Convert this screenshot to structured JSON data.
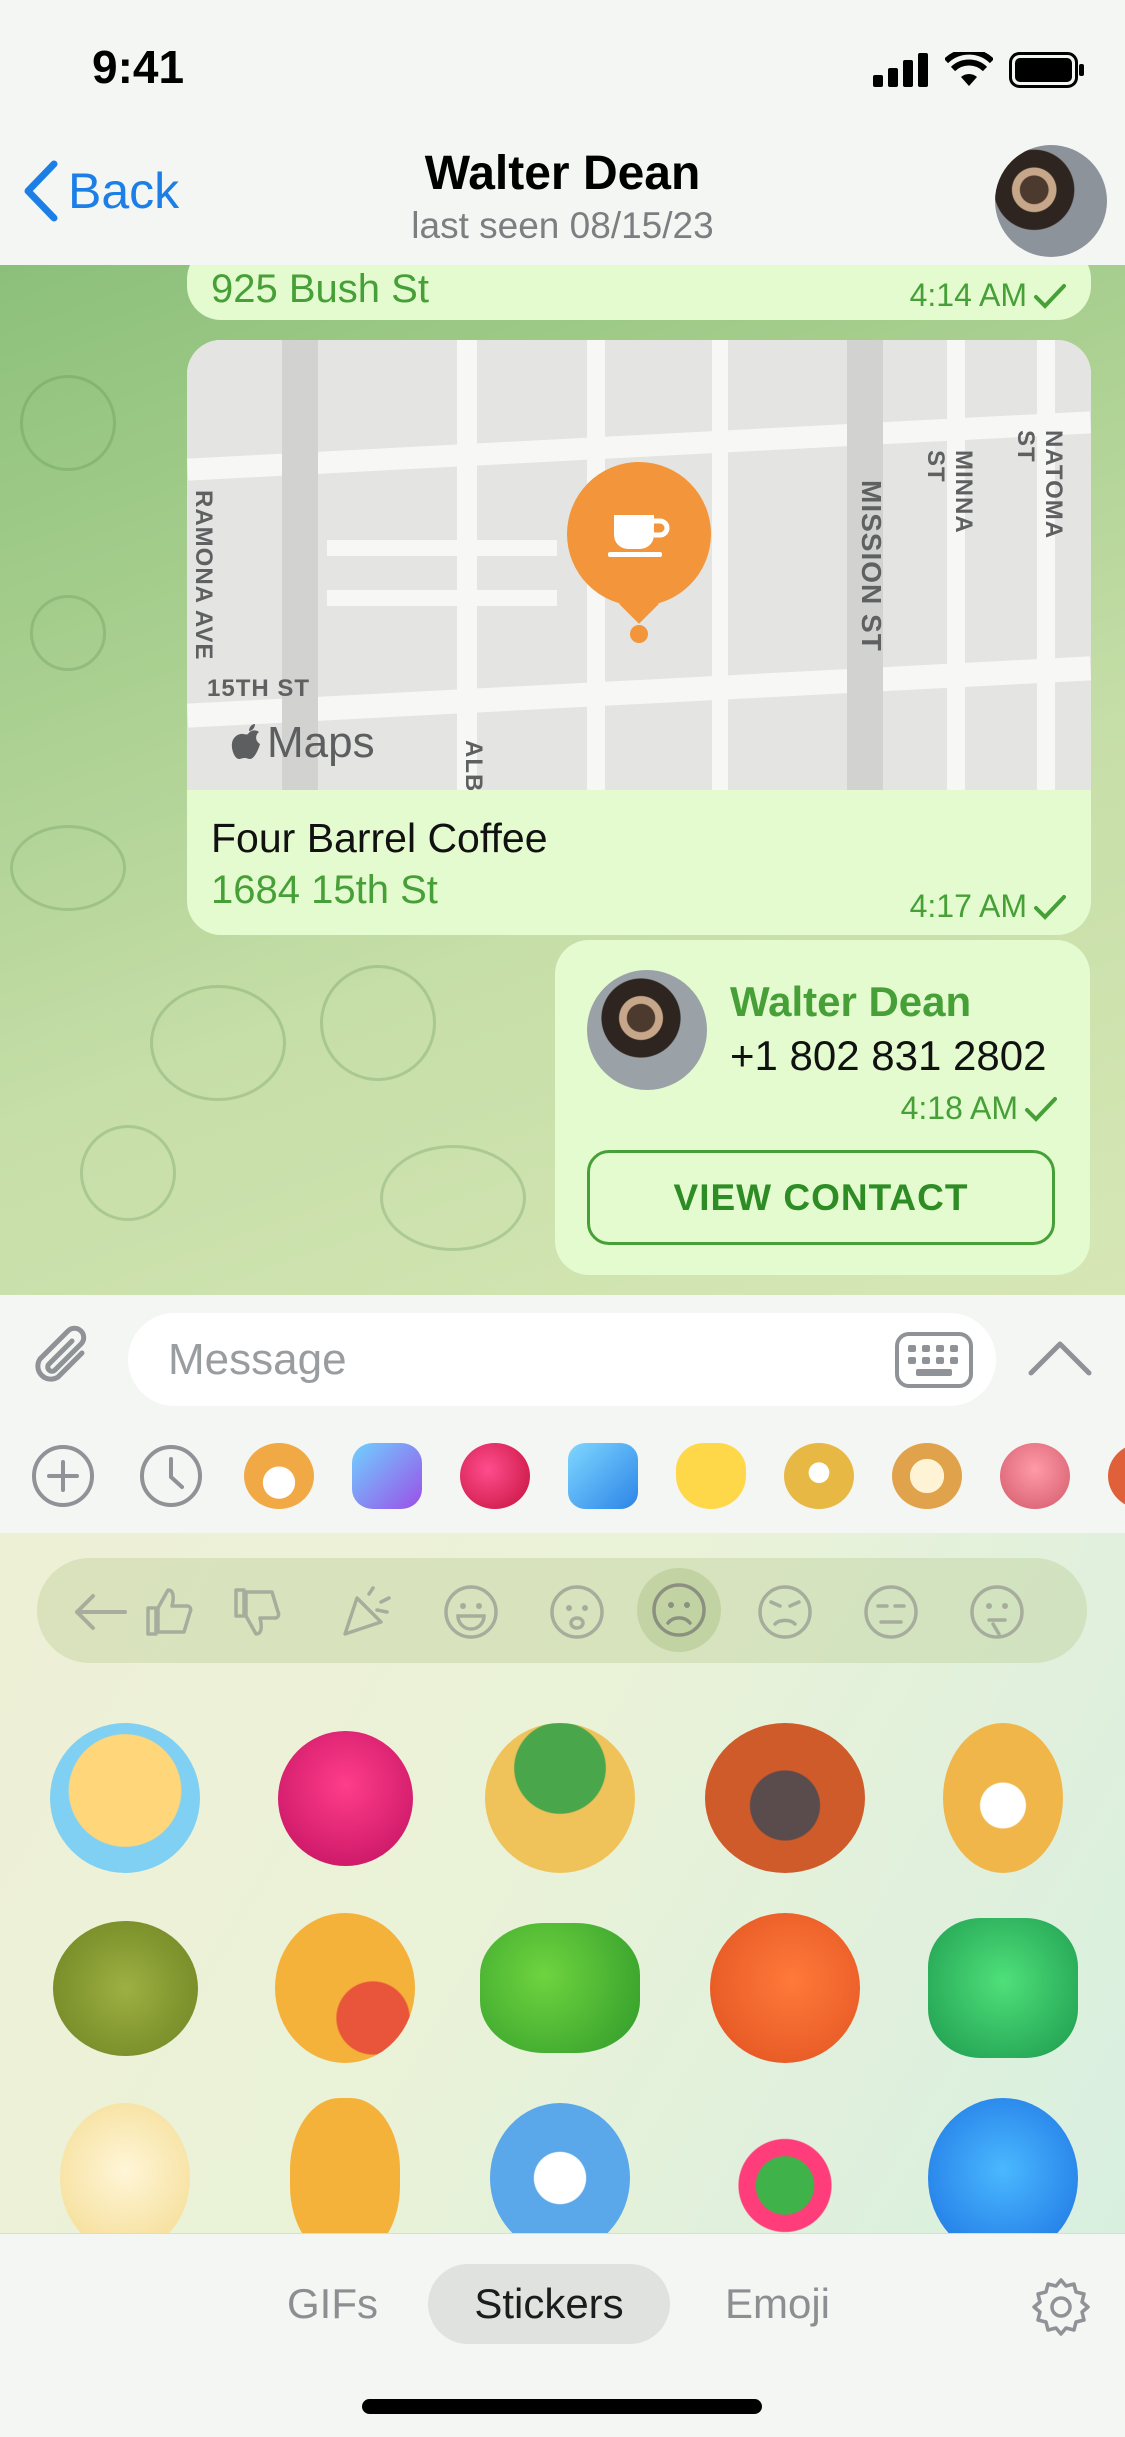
{
  "status_bar": {
    "time": "9:41"
  },
  "header": {
    "back_label": "Back",
    "contact_name": "Walter Dean",
    "last_seen": "last seen 08/15/23"
  },
  "messages": {
    "address": {
      "text": "925 Bush St",
      "time": "4:14 AM"
    },
    "location": {
      "venue": "Four Barrel Coffee",
      "address": "1684 15th St",
      "time": "4:17 AM",
      "map_provider": "Maps",
      "street_labels": [
        "MISSION ST",
        "MINNA ST",
        "NATOMA ST",
        "RAMONA AVE",
        "15TH ST",
        "ALB"
      ]
    },
    "contact": {
      "name": "Walter Dean",
      "phone": "+1 802 831 2802",
      "time": "4:18 AM",
      "button": "VIEW CONTACT"
    }
  },
  "composer": {
    "placeholder": "Message"
  },
  "tabs": {
    "gifs": "GIFs",
    "stickers": "Stickers",
    "emoji": "Emoji",
    "active": "Stickers"
  },
  "sticker_set_icons": [
    "add-icon",
    "recent-clock-icon",
    "shiba-pack",
    "ok-pack",
    "cherry-pack",
    "number-pack",
    "hands-pack",
    "owl-pack",
    "cat-pack",
    "tongue-pack"
  ],
  "emoji_categories": [
    "back",
    "thumbs-up",
    "thumbs-down",
    "party",
    "grinning",
    "sad",
    "frowning",
    "angry",
    "neutral",
    "thinking"
  ],
  "colors": {
    "accent": "#46a037",
    "link": "#1c7fe6",
    "bubble": "#e3fbcf",
    "pin": "#f2953b"
  }
}
